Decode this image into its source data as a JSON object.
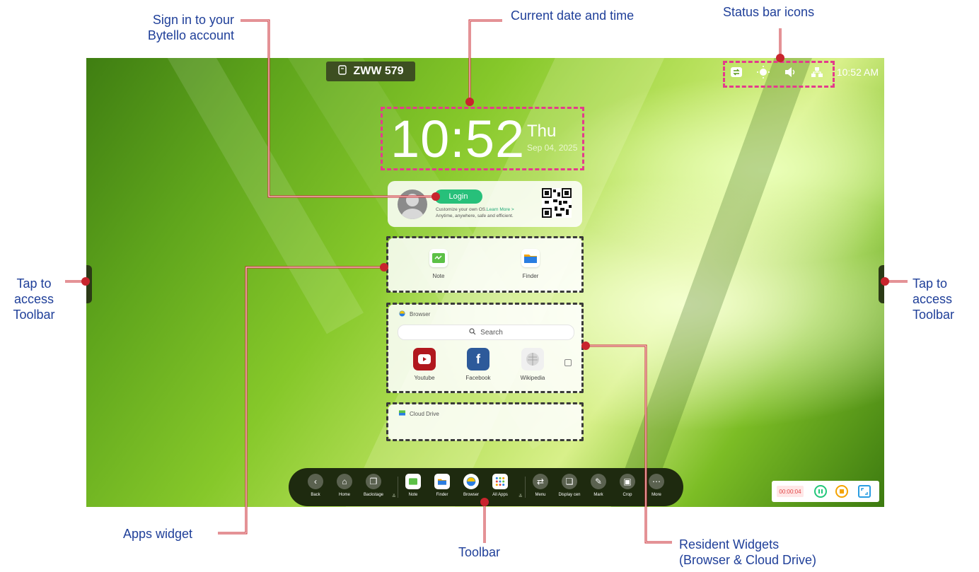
{
  "annotations": {
    "signin": [
      "Sign in to your",
      "Bytello account"
    ],
    "datetime": "Current date and time",
    "status_icons": "Status bar icons",
    "tap_left": [
      "Tap to",
      "access",
      "Toolbar"
    ],
    "tap_right": [
      "Tap to",
      "access",
      "Toolbar"
    ],
    "apps_widget": "Apps widget",
    "toolbar": "Toolbar",
    "resident": [
      "Resident Widgets",
      "(Browser & Cloud Drive)"
    ]
  },
  "screen": {
    "device_name": "ZWW 579",
    "status_time": "10:52 AM",
    "status_icons": [
      "screen-share-icon",
      "brightness-icon",
      "volume-icon",
      "network-icon"
    ],
    "clock": {
      "time": "10:52",
      "day": "Thu",
      "date": "Sep 04, 2025"
    },
    "login": {
      "button": "Login",
      "line1_prefix": "Customize your own OS.",
      "line1_link": "Learn More >",
      "line2": "Anytime, anywhere, safe and efficient."
    },
    "apps": [
      {
        "label": "Note",
        "icon": "note-icon"
      },
      {
        "label": "Finder",
        "icon": "finder-icon"
      }
    ],
    "browser": {
      "title": "Browser",
      "search": "Search",
      "sites": [
        {
          "label": "Youtube",
          "color": "#b1181e"
        },
        {
          "label": "Facebook",
          "color": "#2d5a9a"
        },
        {
          "label": "Wikipedia",
          "color": "#eeeeee"
        }
      ]
    },
    "cloud": {
      "title": "Cloud Drive"
    },
    "toolbar": {
      "left": [
        "Back",
        "Home",
        "Backstage"
      ],
      "apps": [
        "Note",
        "Finder",
        "Browser",
        "All Apps"
      ],
      "tools": [
        "Menu",
        "Display cen",
        "Mark",
        "Crop",
        "More"
      ]
    },
    "recorder": {
      "time": "00:00:04"
    }
  },
  "colors": {
    "accent": "#c8252d",
    "highlight": "#e43b8c",
    "annotation_text": "#1f3f99",
    "login_green": "#27c07a"
  }
}
